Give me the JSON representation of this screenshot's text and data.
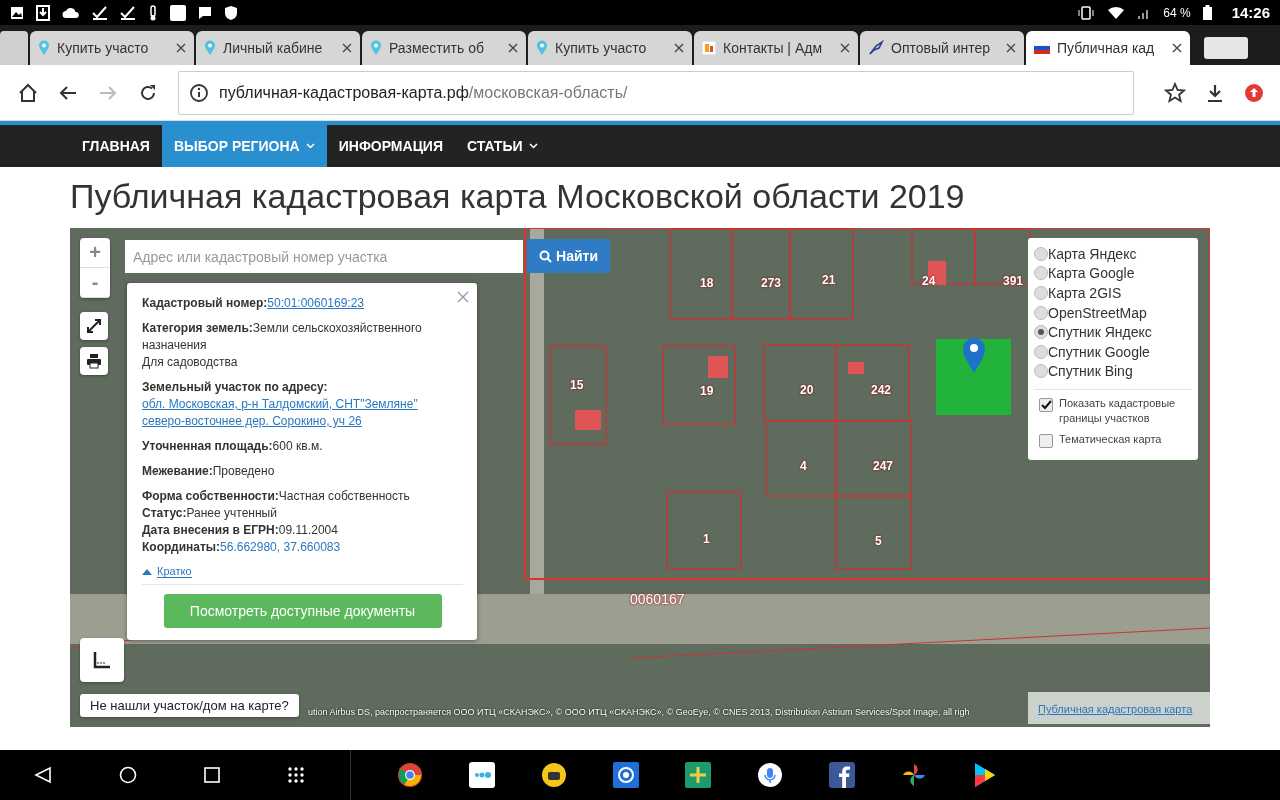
{
  "status_bar": {
    "battery": "64 %",
    "time": "14:26"
  },
  "tabs": [
    {
      "title": "Купить участо",
      "kind": "pin",
      "selected": false
    },
    {
      "title": "Личный кабине",
      "kind": "pin",
      "selected": false
    },
    {
      "title": "Разместить об",
      "kind": "pin",
      "selected": false
    },
    {
      "title": "Купить участо",
      "kind": "pin",
      "selected": false
    },
    {
      "title": "Контакты | Адм",
      "kind": "favicon",
      "selected": false
    },
    {
      "title": "Оптовый интер",
      "kind": "bird",
      "selected": false
    },
    {
      "title": "Публичная кад",
      "kind": "flag",
      "selected": true
    }
  ],
  "address_bar": {
    "host": "публичная-кадастровая-карта.рф",
    "path": "/московская-область/"
  },
  "nav": [
    {
      "label": "ГЛАВНАЯ",
      "selected": false,
      "dropdown": false
    },
    {
      "label": "ВЫБОР РЕГИОНА",
      "selected": true,
      "dropdown": true
    },
    {
      "label": "ИНФОРМАЦИЯ",
      "selected": false,
      "dropdown": false
    },
    {
      "label": "СТАТЬИ",
      "selected": false,
      "dropdown": true
    }
  ],
  "page_title": "Публичная кадастровая карта Московской области 2019",
  "map": {
    "zoom_in": "+",
    "zoom_out": "-",
    "search": {
      "placeholder": "Адрес или кадастровый номер участка",
      "button": "Найти"
    },
    "parcels": [
      "18",
      "273",
      "21",
      "24",
      "391",
      "15",
      "19",
      "20",
      "242",
      "4",
      "247",
      "1",
      "5"
    ],
    "block_label": "0060167",
    "popup": {
      "sections": [
        [
          {
            "label": "Кадастровый номер:",
            "value": "50:01:0060169:23",
            "kind": "link"
          }
        ],
        [
          {
            "label": "Категория земель:",
            "value": "Земли сельскохозяйственного назначения",
            "kind": "text"
          },
          {
            "value": "Для садоводства",
            "kind": "text"
          }
        ],
        [
          {
            "label": "Земельный участок по адресу:",
            "value": "обл. Московская, р-н Талдомский, СНТ\"Земляне\" северо-восточнее дер. Сорокино, уч 26",
            "kind": "link"
          }
        ],
        [
          {
            "label": "Уточненная площадь:",
            "value": "600 кв.м.",
            "kind": "text"
          }
        ],
        [
          {
            "label": "Межевание:",
            "value": "Проведено",
            "kind": "text"
          }
        ],
        [
          {
            "label": "Форма собственности:",
            "value": "Частная собственность",
            "kind": "text"
          },
          {
            "label": "Статус:",
            "value": "Ранее учтенный",
            "kind": "text"
          },
          {
            "label": "Дата внесения в ЕГРН:",
            "value": "09.11.2004",
            "kind": "text"
          },
          {
            "label": "Координаты:",
            "value": "56.662980, 37.660083",
            "kind": "coords"
          }
        ]
      ],
      "toggle": "Кратко",
      "button": "Посмотреть доступные документы"
    },
    "layers": [
      {
        "label": "Карта Яндекс",
        "selected": false
      },
      {
        "label": "Карта Google",
        "selected": false
      },
      {
        "label": "Карта 2GIS",
        "selected": false
      },
      {
        "label": "OpenStreetMap",
        "selected": false
      },
      {
        "label": "Спутник Яндекс",
        "selected": true
      },
      {
        "label": "Спутник Google",
        "selected": false
      },
      {
        "label": "Спутник Bing",
        "selected": false
      }
    ],
    "options": [
      {
        "label": "Показать кадастровые границы участков",
        "checked": true
      },
      {
        "label": "Тематическая карта",
        "checked": false
      }
    ],
    "help": "Не нашли участок/дом на карте?",
    "attribution": "ution Airbus DS, распространяется ООО ИТЦ «СКАНЭКС», © ООО ИТЦ «СКАНЭКС», © GeoEye, © CNES 2013, Distribution Astrium Services/Spot Image, all righ",
    "source_link": "Публичная кадастровая карта"
  }
}
